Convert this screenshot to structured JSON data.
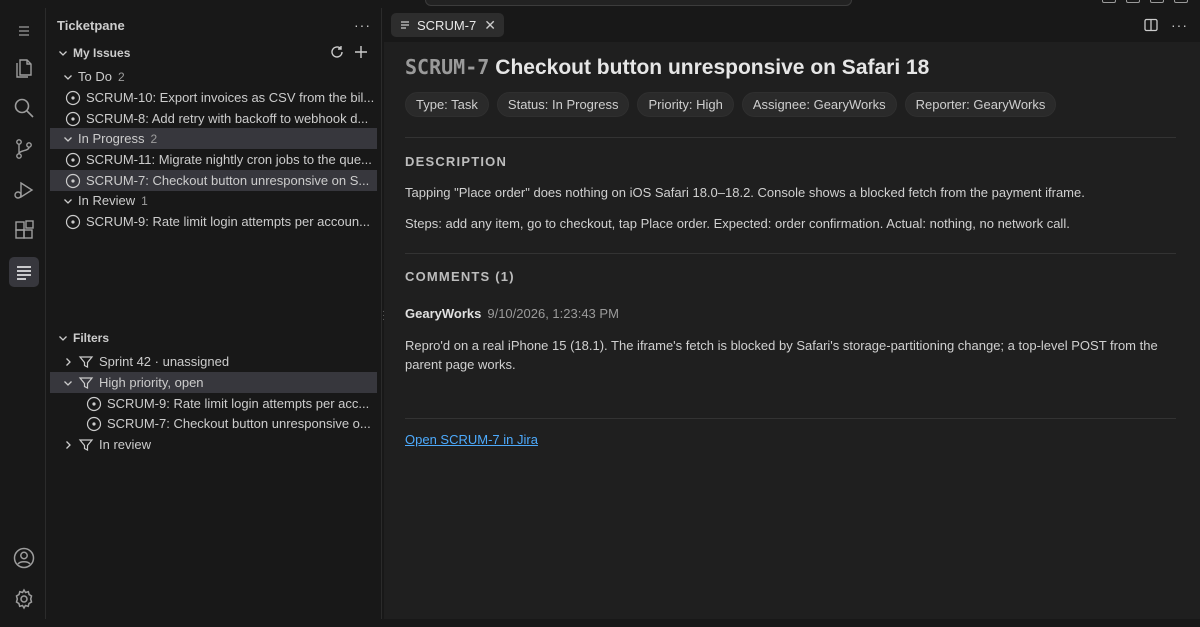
{
  "window": {
    "icons": [
      "layout-icon",
      "layout-icon",
      "layout-icon",
      "layout-icon"
    ]
  },
  "activity_bar": {
    "items": [
      {
        "name": "menu-icon"
      },
      {
        "name": "explorer-icon"
      },
      {
        "name": "search-icon"
      },
      {
        "name": "source-control-icon"
      },
      {
        "name": "run-debug-icon"
      },
      {
        "name": "extensions-icon"
      },
      {
        "name": "ticketpane-icon",
        "active": true
      }
    ],
    "bottom": [
      {
        "name": "account-icon"
      },
      {
        "name": "settings-gear-icon"
      }
    ]
  },
  "sidebar": {
    "title": "Ticketpane",
    "my_issues": {
      "label": "My Issues",
      "groups": [
        {
          "label": "To Do",
          "count": "2",
          "items": [
            "SCRUM-10: Export invoices as CSV from the bil...",
            "SCRUM-8: Add retry with backoff to webhook d..."
          ]
        },
        {
          "label": "In Progress",
          "count": "2",
          "items": [
            "SCRUM-11: Migrate nightly cron jobs to the que...",
            "SCRUM-7: Checkout button unresponsive on S..."
          ]
        },
        {
          "label": "In Review",
          "count": "1",
          "items": [
            "SCRUM-9: Rate limit login attempts per accoun..."
          ]
        }
      ]
    },
    "filters": {
      "label": "Filters",
      "items": [
        {
          "label": "Sprint 42 · unassigned",
          "expanded": false
        },
        {
          "label": "High priority, open",
          "expanded": true,
          "children": [
            "SCRUM-9: Rate limit login attempts per acc...",
            "SCRUM-7: Checkout button unresponsive o..."
          ]
        },
        {
          "label": "In review",
          "expanded": false
        }
      ]
    }
  },
  "editor": {
    "tab": {
      "label": "SCRUM-7"
    },
    "issue": {
      "key": "SCRUM-7",
      "title": "Checkout button unresponsive on Safari 18",
      "chips": [
        "Type: Task",
        "Status: In Progress",
        "Priority: High",
        "Assignee: GearyWorks",
        "Reporter: GearyWorks"
      ],
      "description_label": "DESCRIPTION",
      "description": [
        "Tapping \"Place order\" does nothing on iOS Safari 18.0–18.2. Console shows a blocked fetch from the payment iframe.",
        "Steps: add any item, go to checkout, tap Place order. Expected: order confirmation. Actual: nothing, no network call."
      ],
      "comments_label": "COMMENTS (1)",
      "comments": [
        {
          "author": "GearyWorks",
          "time": "9/10/2026, 1:23:43 PM",
          "body": "Repro'd on a real iPhone 15 (18.1). The iframe's fetch is blocked by Safari's storage-partitioning change; a top-level POST from the parent page works."
        }
      ],
      "link_label": "Open SCRUM-7 in Jira"
    }
  },
  "colors": {
    "background": "#181818",
    "editor_bg": "#1f1f1f",
    "selection": "#37373d",
    "link": "#4daafc"
  }
}
